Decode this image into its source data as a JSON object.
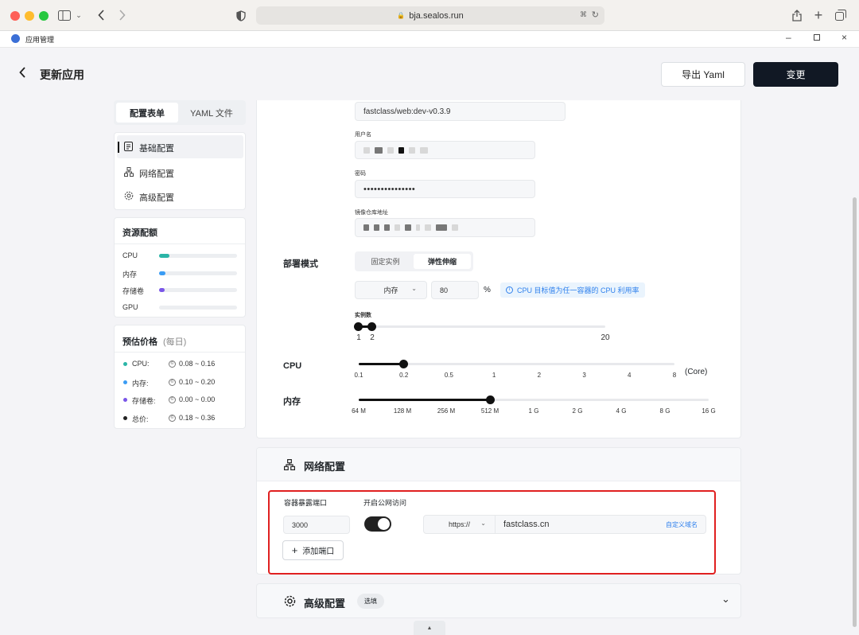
{
  "browser": {
    "url": "bja.sealos.run",
    "tab_title": "应用管理"
  },
  "header": {
    "title": "更新应用",
    "export_label": "导出 Yaml",
    "apply_label": "变更"
  },
  "left": {
    "tabs": [
      "配置表单",
      "YAML 文件"
    ],
    "nav": [
      "基础配置",
      "网络配置",
      "高级配置"
    ],
    "resources": {
      "title": "资源配额",
      "items": [
        {
          "label": "CPU",
          "fill": 0.13,
          "color": "#2bb5a7"
        },
        {
          "label": "内存",
          "fill": 0.08,
          "color": "#3a9cf4"
        },
        {
          "label": "存储卷",
          "fill": 0.07,
          "color": "#7a56e8"
        },
        {
          "label": "GPU",
          "fill": 0,
          "color": "#bbbbbb"
        }
      ]
    },
    "price": {
      "title": "预估价格",
      "subtitle": "(每日)",
      "items": [
        {
          "label": "CPU:",
          "value": "0.08 ~ 0.16",
          "color": "#2bb5a7"
        },
        {
          "label": "内存:",
          "value": "0.10 ~ 0.20",
          "color": "#3a9cf4"
        },
        {
          "label": "存储卷:",
          "value": "0.00 ~ 0.00",
          "color": "#7a56e8"
        },
        {
          "label": "总价:",
          "value": "0.18 ~ 0.36",
          "color": "#222222"
        }
      ]
    }
  },
  "main": {
    "image_name": "fastclass/web:dev-v0.3.9",
    "username_label": "用户名",
    "password_label": "密码",
    "password_value": "•••••••••••••••",
    "registry_label": "镜像仓库地址",
    "deploy_mode_label": "部署模式",
    "mode_options": [
      "固定实例",
      "弹性伸缩"
    ],
    "mode_selected": "弹性伸缩",
    "metric_select": "内存",
    "metric_value": "80",
    "metric_unit": "%",
    "metric_hint": "CPU 目标值为任一容器的 CPU 利用率",
    "instances_label": "实例数",
    "instances": {
      "min": 1,
      "max": 2,
      "range_max": 20
    },
    "cpu_label": "CPU",
    "cpu_ticks": [
      "0.1",
      "0.2",
      "0.5",
      "1",
      "2",
      "3",
      "4",
      "8"
    ],
    "cpu_unit": "(Core)",
    "cpu_value": "0.2",
    "memory_label": "内存",
    "memory_ticks": [
      "64 M",
      "128 M",
      "256 M",
      "512 M",
      "1 G",
      "2 G",
      "4 G",
      "8 G",
      "16 G"
    ],
    "memory_value": "512 M"
  },
  "network": {
    "title": "网络配置",
    "port_label": "容器暴露端口",
    "public_label": "开启公网访问",
    "port_value": "3000",
    "public_enabled": true,
    "protocol": "https://",
    "domain": "fastclass.cn",
    "custom_domain": "自定义域名",
    "add_port": "添加端口"
  },
  "advanced": {
    "title": "高级配置",
    "badge": "选填"
  },
  "colors": {
    "accent_dark": "#111824",
    "highlight_border": "#e02020",
    "hint_blue": "#2f80ed"
  }
}
